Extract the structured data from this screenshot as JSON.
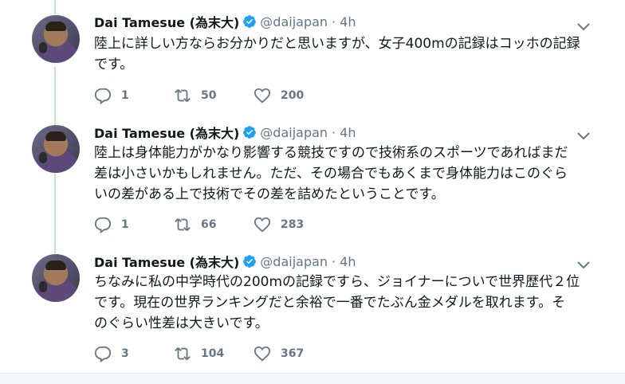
{
  "tweets": [
    {
      "name": "Dai Tamesue (為末大)",
      "handle": "@daijapan",
      "separator": "·",
      "time": "4h",
      "text_lines": [
        "陸上に詳しい方ならお分かりだと思いますが、女子400mの記録はコッホの記録",
        "です。"
      ],
      "replies": "1",
      "retweets": "50",
      "likes": "200"
    },
    {
      "name": "Dai Tamesue (為末大)",
      "handle": "@daijapan",
      "separator": "·",
      "time": "4h",
      "text_lines": [
        "陸上は身体能力がかなり影響する競技ですので技術系のスポーツであればまだ",
        "差は小さいかもしれません。ただ、その場合でもあくまで身体能力はこのぐら",
        "いの差がある上で技術でその差を詰めたということです。"
      ],
      "replies": "1",
      "retweets": "66",
      "likes": "283"
    },
    {
      "name": "Dai Tamesue (為末大)",
      "handle": "@daijapan",
      "separator": "·",
      "time": "4h",
      "text_lines": [
        "ちなみに私の中学時代の200mの記録ですら、ジョイナーについで世界歴代２位",
        "です。現在の世界ランキングだと余裕で一番でたぶん金メダルを取れます。そ",
        "のぐらい性差は大きいです。"
      ],
      "replies": "3",
      "retweets": "104",
      "likes": "367"
    }
  ],
  "colors": {
    "verified": "#1da1f2",
    "muted": "#657786",
    "text": "#14171a",
    "thread_line": "#ccd6dd",
    "thread_line_green": "#c2e6c2"
  },
  "icons": {
    "reply": "reply-icon",
    "retweet": "retweet-icon",
    "like": "heart-icon",
    "verified": "verified-badge-icon",
    "more": "chevron-down-icon"
  }
}
